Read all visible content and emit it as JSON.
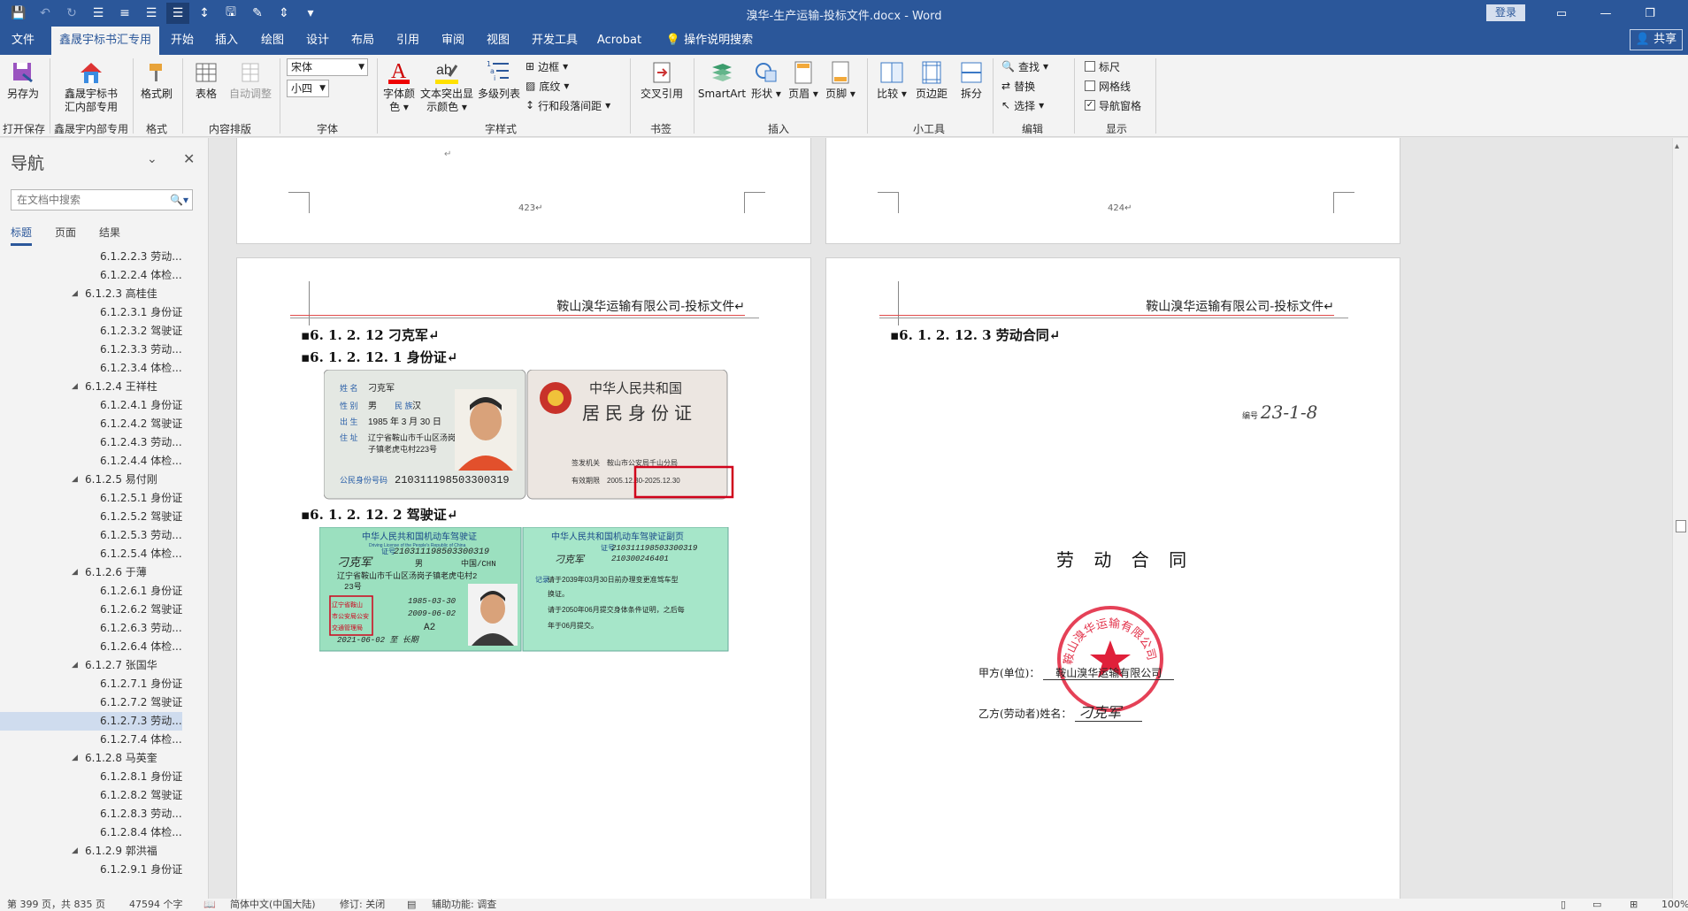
{
  "window": {
    "title": "溴华-生产运输-投标文件.docx  -  Word",
    "login": "登录",
    "share": "共享"
  },
  "tabs": [
    "文件",
    "鑫晟宇标书汇专用",
    "开始",
    "插入",
    "绘图",
    "设计",
    "布局",
    "引用",
    "审阅",
    "视图",
    "开发工具",
    "Acrobat",
    "操作说明搜索"
  ],
  "ribbon": {
    "save_as": "另存为",
    "xsy_line1": "鑫晟宇标书",
    "xsy_line2": "汇内部专用",
    "format_painter": "格式刷",
    "table": "表格",
    "auto_adjust": "自动调整",
    "font_name": "宋体",
    "font_size": "小四",
    "font_color_1": "字体颜",
    "font_color_2": "色",
    "highlight_1": "文本突出显",
    "highlight_2": "示颜色",
    "multilevel": "多级列表",
    "border": "边框",
    "shading": "底纹",
    "para_spacing": "行和段落间距",
    "cross_ref": "交叉引用",
    "smartart": "SmartArt",
    "shape": "形状",
    "header": "页眉",
    "footer": "页脚",
    "compare": "比较",
    "margins": "页边距",
    "split": "拆分",
    "find": "查找",
    "replace": "替换",
    "select": "选择",
    "ruler": "标尺",
    "gridlines": "网格线",
    "nav_pane": "导航窗格",
    "groups": {
      "open_save": "打开保存",
      "xsy": "鑫晟宇内部专用",
      "format": "格式",
      "content": "内容排版",
      "font": "字体",
      "style": "字样式",
      "bookmark": "书签",
      "insert": "插入",
      "tools": "小工具",
      "edit": "编辑",
      "display": "显示"
    }
  },
  "nav": {
    "title": "导航",
    "search_placeholder": "在文档中搜索",
    "tabs": [
      "标题",
      "页面",
      "结果"
    ],
    "items": [
      {
        "level": 4,
        "text": "6.1.2.2.3 劳动..."
      },
      {
        "level": 4,
        "text": "6.1.2.2.4 体检..."
      },
      {
        "level": 3,
        "text": "6.1.2.3 高桂佳"
      },
      {
        "level": 4,
        "text": "6.1.2.3.1 身份证"
      },
      {
        "level": 4,
        "text": "6.1.2.3.2 驾驶证"
      },
      {
        "level": 4,
        "text": "6.1.2.3.3 劳动..."
      },
      {
        "level": 4,
        "text": "6.1.2.3.4 体检..."
      },
      {
        "level": 3,
        "text": "6.1.2.4 王祥柱"
      },
      {
        "level": 4,
        "text": "6.1.2.4.1 身份证"
      },
      {
        "level": 4,
        "text": "6.1.2.4.2 驾驶证"
      },
      {
        "level": 4,
        "text": "6.1.2.4.3 劳动..."
      },
      {
        "level": 4,
        "text": "6.1.2.4.4 体检..."
      },
      {
        "level": 3,
        "text": "6.1.2.5 易付刚"
      },
      {
        "level": 4,
        "text": "6.1.2.5.1 身份证"
      },
      {
        "level": 4,
        "text": "6.1.2.5.2 驾驶证"
      },
      {
        "level": 4,
        "text": "6.1.2.5.3 劳动..."
      },
      {
        "level": 4,
        "text": "6.1.2.5.4 体检..."
      },
      {
        "level": 3,
        "text": "6.1.2.6 于薄"
      },
      {
        "level": 4,
        "text": "6.1.2.6.1 身份证"
      },
      {
        "level": 4,
        "text": "6.1.2.6.2 驾驶证"
      },
      {
        "level": 4,
        "text": "6.1.2.6.3 劳动..."
      },
      {
        "level": 4,
        "text": "6.1.2.6.4 体检..."
      },
      {
        "level": 3,
        "text": "6.1.2.7 张国华"
      },
      {
        "level": 4,
        "text": "6.1.2.7.1 身份证"
      },
      {
        "level": 4,
        "text": "6.1.2.7.2 驾驶证"
      },
      {
        "level": 4,
        "text": "6.1.2.7.3 劳动...",
        "selected": true
      },
      {
        "level": 4,
        "text": "6.1.2.7.4 体检..."
      },
      {
        "level": 3,
        "text": "6.1.2.8 马英奎"
      },
      {
        "level": 4,
        "text": "6.1.2.8.1 身份证"
      },
      {
        "level": 4,
        "text": "6.1.2.8.2 驾驶证"
      },
      {
        "level": 4,
        "text": "6.1.2.8.3 劳动..."
      },
      {
        "level": 4,
        "text": "6.1.2.8.4 体检..."
      },
      {
        "level": 3,
        "text": "6.1.2.9 郭洪福"
      },
      {
        "level": 4,
        "text": "6.1.2.9.1 身份证"
      }
    ]
  },
  "doc": {
    "page_423": "423↵",
    "page_424": "424↵",
    "header_text": "鞍山溴华运输有限公司-投标文件↵",
    "h_person": "6. 1. 2. 12    刁克军↵",
    "h_id": "6. 1. 2. 12. 1 身份证↵",
    "h_license": "6. 1. 2. 12. 2 驾驶证↵",
    "h_contract": "6. 1. 2. 12. 3 劳动合同↵",
    "id_card": {
      "back_title": "中华人民共和国",
      "back_sub": "居民身份证",
      "name": "刁克军",
      "sex": "男",
      "ethnic": "汉",
      "birth": "1985  年  3  月 30 日",
      "addr1": "辽宁省鞍山市千山区汤岗",
      "addr2": "子镇老虎屯村223号",
      "id_no": "210311198503300319",
      "issuer": "鞍山市公安局千山分局",
      "valid": "2005.12.30-2025.12.30",
      "l_name": "姓  名",
      "l_sex": "性  别",
      "l_ethnic": "民  族",
      "l_birth": "出  生",
      "l_addr": "住  址",
      "l_id": "公民身份号码",
      "l_issuer": "签发机关",
      "l_valid": "有效期限"
    },
    "license": {
      "title": "中华人民共和国机动车驾驶证",
      "title_en": "Driving License of the People's Republic of China",
      "title_copy": "中华人民共和国机动车驾驶证副页",
      "card_no": "210311198503300319",
      "name": "刁克军",
      "sex": "男",
      "nation": "中国/CHN",
      "addr": "辽宁省鞍山市千山区汤岗子镇老虎屯村2",
      "addr2": "23号",
      "birth": "1985-03-30",
      "first_issue": "2009-06-02",
      "class": "A2",
      "valid": "2021-06-02 至 长期",
      "stamp1": "辽宁省鞍山",
      "stamp2": "市公安局公安",
      "stamp3": "交通管理局",
      "copy_no": "210311198503300319",
      "copy_file": "210300246401",
      "copy_name": "刁克军",
      "record1": "请于2039年03月30日前办理变更准驾车型",
      "record2": "换证。",
      "record3": "请于2050年06月提交身体条件证明，之后每",
      "record4": "年于06月提交。",
      "l_zheng": "证号",
      "l_record": "记录"
    },
    "contract": {
      "serial_label": "编号",
      "serial_value": "23-1-8",
      "title": "劳 动 合 同",
      "party_a_label": "甲方(单位)：",
      "party_a": "鞍山溴华运输有限公司",
      "party_b_label": "乙方(劳动者)姓名：",
      "party_b": "刁克军",
      "seal_text": "鞍山溴华运输有限公司"
    }
  },
  "status": {
    "page": "第 399 页，共 835 页",
    "words": "47594 个字",
    "lang": "简体中文(中国大陆)",
    "track": "修订: 关闭",
    "access": "辅助功能: 调查",
    "zoom": "100%"
  },
  "colors": {
    "word_blue": "#2b579a",
    "highlight_red": "#d0021b",
    "seal_red": "#e0203a"
  }
}
